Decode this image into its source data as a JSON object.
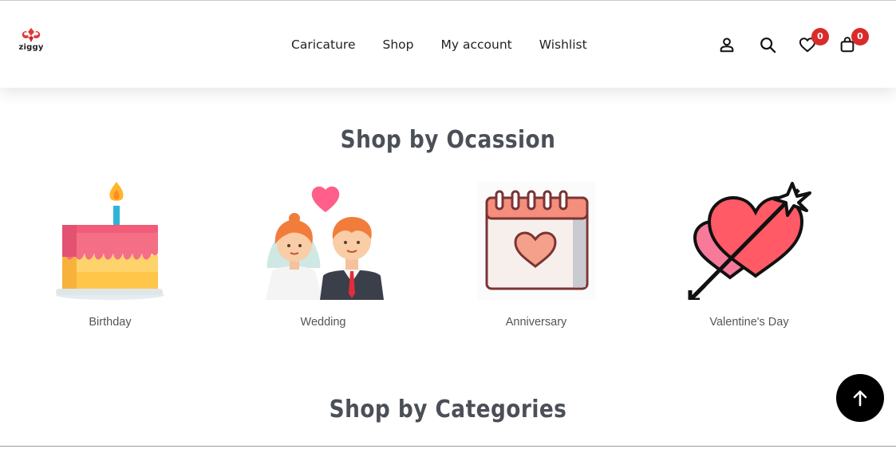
{
  "brand": {
    "name": "ziggy",
    "logo_color": "#e03b3b"
  },
  "nav": {
    "items": [
      {
        "label": "Caricature"
      },
      {
        "label": "Shop"
      },
      {
        "label": "My account"
      },
      {
        "label": "Wishlist"
      }
    ]
  },
  "header_icons": {
    "account": "user-icon",
    "search": "search-icon",
    "wishlist": {
      "icon": "heart-icon",
      "count": "0"
    },
    "cart": {
      "icon": "bag-icon",
      "count": "0"
    }
  },
  "sections": {
    "occasion": {
      "title": "Shop by Ocassion",
      "items": [
        {
          "label": "Birthday",
          "icon": "cake-icon"
        },
        {
          "label": "Wedding",
          "icon": "wedding-couple-icon"
        },
        {
          "label": "Anniversary",
          "icon": "calendar-heart-icon"
        },
        {
          "label": "Valentine's Day",
          "icon": "hearts-arrow-icon"
        }
      ]
    },
    "categories": {
      "title": "Shop by Categories"
    }
  },
  "colors": {
    "badge": "#d92b2b",
    "heading": "#4b4f57",
    "back_to_top": "#000000"
  },
  "back_to_top": {
    "icon": "arrow-up-icon"
  }
}
